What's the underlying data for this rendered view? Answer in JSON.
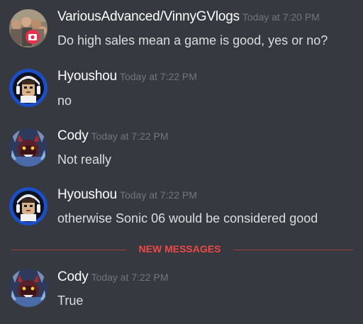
{
  "colors": {
    "background": "#36393f",
    "author": "#ffffff",
    "message": "#dcddde",
    "timestamp": "#72767d",
    "new_messages": "#f04747"
  },
  "messages": [
    {
      "author": "VariousAdvanced/VinnyGVlogs",
      "timestamp": "Today at 7:20 PM",
      "text": "Do high sales mean a game is good, yes or no?",
      "avatar_icon": "crowd-with-camera-badge-avatar"
    },
    {
      "author": "Hyoushou",
      "timestamp": "Today at 7:22 PM",
      "text": "no",
      "avatar_icon": "blue-ring-helmet-avatar"
    },
    {
      "author": "Cody",
      "timestamp": "Today at 7:22 PM",
      "text": "Not really",
      "avatar_icon": "red-horned-character-avatar"
    },
    {
      "author": "Hyoushou",
      "timestamp": "Today at 7:22 PM",
      "text": "otherwise Sonic 06 would be considered good",
      "avatar_icon": "blue-ring-helmet-avatar"
    },
    {
      "author": "Cody",
      "timestamp": "Today at 7:22 PM",
      "text": "True",
      "avatar_icon": "red-horned-character-avatar"
    }
  ],
  "divider": {
    "label": "NEW MESSAGES"
  }
}
